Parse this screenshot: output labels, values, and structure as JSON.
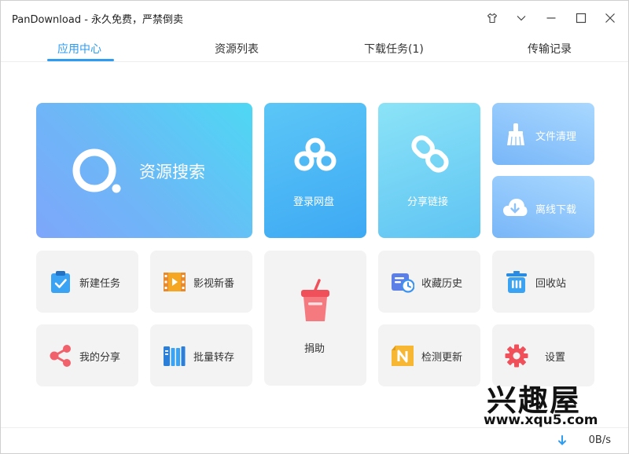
{
  "window": {
    "title": "PanDownload - 永久免费，严禁倒卖"
  },
  "controls": {
    "pin_icon": "shirt-icon",
    "dropdown_icon": "chevron-down-icon",
    "minimize_icon": "minimize-icon",
    "maximize_icon": "maximize-icon",
    "close_icon": "close-icon"
  },
  "tabs": [
    {
      "label": "应用中心",
      "active": true
    },
    {
      "label": "资源列表",
      "active": false
    },
    {
      "label": "下载任务(1)",
      "active": false
    },
    {
      "label": "传输记录",
      "active": false
    }
  ],
  "tiles": {
    "search": {
      "label": "资源搜索",
      "icon": "search-icon"
    },
    "login": {
      "label": "登录网盘",
      "icon": "baidu-cloud-icon"
    },
    "share_link": {
      "label": "分享链接",
      "icon": "link-icon"
    },
    "clean": {
      "label": "文件清理",
      "icon": "broom-icon"
    },
    "offline": {
      "label": "离线下载",
      "icon": "cloud-download-icon"
    },
    "new_task": {
      "label": "新建任务",
      "icon": "clipboard-check-icon"
    },
    "video": {
      "label": "影视新番",
      "icon": "film-icon"
    },
    "donate": {
      "label": "捐助",
      "icon": "cup-icon"
    },
    "history": {
      "label": "收藏历史",
      "icon": "history-icon"
    },
    "recycle": {
      "label": "回收站",
      "icon": "trash-icon"
    },
    "my_share": {
      "label": "我的分享",
      "icon": "share-icon"
    },
    "batch": {
      "label": "批量转存",
      "icon": "books-icon"
    },
    "update": {
      "label": "检测更新",
      "icon": "update-n-icon"
    },
    "settings": {
      "label": "设置",
      "icon": "gear-icon"
    }
  },
  "status": {
    "speed": "0B/s",
    "icon": "download-arrow-icon"
  },
  "watermark": {
    "text": "兴趣屋",
    "url": "www.xqu5.com"
  },
  "colors": {
    "accent": "#2e9cf0",
    "tile_gray": "#f3f3f3"
  }
}
